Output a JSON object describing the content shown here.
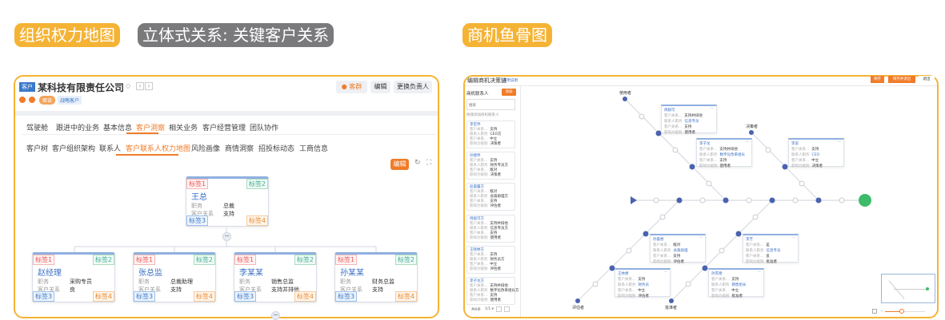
{
  "labels": {
    "org_map": "组织权力地图",
    "relation": "立体式关系: 关键客户关系",
    "fishbone": "商机鱼骨图"
  },
  "colors": {
    "accent": "#f5b335",
    "orange": "#f07c2a",
    "blue": "#3a6fc4",
    "gray_pill": "#7a7a7c"
  },
  "left": {
    "badge": "客户",
    "company": "某科技有限责任公司",
    "buttons": {
      "group": "客群",
      "edit": "编辑",
      "change_owner": "更换负责人"
    },
    "tags": {
      "meeting": "面谈",
      "strategic": "战略客户"
    },
    "tabs": [
      "驾驶舱",
      "跟进中的业务",
      "基本信息",
      "客户洞察",
      "相关业务",
      "客户经营管理",
      "团队协作"
    ],
    "active_tab": "客户洞察",
    "subtabs": [
      "客户树",
      "客户组织架构",
      "联系人",
      "客户联系人权力地图",
      "风险画像",
      "商情洞察",
      "招投标动态",
      "工商信息"
    ],
    "active_subtab": "客户联系人权力地图",
    "edit_label": "编辑",
    "tag_labels": [
      "标签1",
      "标签2",
      "标签3",
      "标签4"
    ],
    "field_labels": {
      "title": "职务",
      "relation": "客户关系"
    },
    "root": {
      "name": "王总",
      "title": "总裁",
      "relation": "支持"
    },
    "children": [
      {
        "name": "赵经理",
        "title": "采购专员",
        "relation": "良"
      },
      {
        "name": "张总监",
        "title": "总裁助理",
        "relation": "支持"
      },
      {
        "name": "李某某",
        "title": "销售总监",
        "relation": "支持并排他"
      },
      {
        "name": "孙某某",
        "title": "财务总监",
        "relation": "支持"
      }
    ]
  },
  "right": {
    "title": "编辑商机决策链",
    "help": "使用说明",
    "buttons": {
      "save": "保存",
      "save_exit": "保存并退出",
      "exit": "退出"
    },
    "sidebar_title": "商机联系人",
    "add": "添加",
    "search_placeholder": "搜索",
    "hint": "拖拽添加商机联系人",
    "row_labels": [
      "客户关系...",
      "联系人职务",
      "客户关系...",
      "影响力级别"
    ],
    "contacts": [
      {
        "name": "李宏伟",
        "v": [
          "支持",
          "CEO方",
          "中立",
          "决策者"
        ]
      },
      {
        "name": "孙建伟",
        "v": [
          "支持",
          "财务专员方",
          "敌对",
          "决策者"
        ]
      },
      {
        "name": "赵晨露方",
        "v": [
          "敌对",
          "总裁助理方",
          "支持",
          "评估者"
        ]
      },
      {
        "name": "周毅可方",
        "v": [
          "支持并排他",
          "信息专员方",
          "支持",
          "使用者"
        ]
      },
      {
        "name": "王晓婷方",
        "v": [
          "支持",
          "财务员方",
          "中立",
          "评估者"
        ]
      },
      {
        "name": "李子龙方",
        "v": [
          "支持并排他",
          "数字化改革组长方",
          "支持",
          "使用者"
        ]
      }
    ],
    "pager": {
      "total": "共6条",
      "page": "1/1"
    },
    "roles": {
      "user": "使用者",
      "decider": "决策者",
      "evaluator": "评估者",
      "approver": "批准者"
    },
    "cards": [
      {
        "name": "周毅可",
        "v": [
          "支持并排他",
          "信息专员",
          "支持",
          "使用者"
        ]
      },
      {
        "name": "李子龙",
        "v": [
          "支持并排他",
          "数字化改革组长",
          "支持",
          "使用者"
        ]
      },
      {
        "name": "李说",
        "v": [
          "支持",
          "CEO",
          "中立",
          "决策者"
        ]
      },
      {
        "name": "孙晨想",
        "v": [
          "敌对",
          "总裁助理",
          "支持",
          "评估者"
        ]
      },
      {
        "name": "王林想",
        "v": [
          "支持",
          "财务员",
          "中立",
          "评估者"
        ]
      },
      {
        "name": "李芳",
        "v": [
          "差",
          "信息专员",
          "良",
          "批准者"
        ]
      },
      {
        "name": "孙贯德",
        "v": [
          "支持",
          "销售组长",
          "中立",
          "批准者"
        ]
      }
    ]
  }
}
